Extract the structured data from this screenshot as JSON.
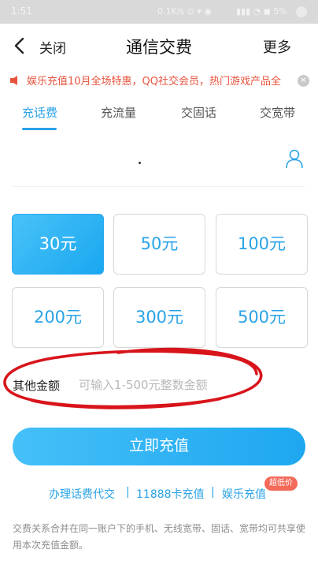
{
  "status_bar": {
    "time": "1:51",
    "center": "0.1K/s ⊙ ▾ ◉",
    "right": "▮▮▮ ◔ ◼ 5%"
  },
  "nav": {
    "back_icon": "chevron-left-icon",
    "close_label": "关闭",
    "title": "通信交费",
    "more_label": "更多"
  },
  "notice": {
    "icon": "speaker-icon",
    "text": "娱乐充值10月全场特惠，QQ社交会员，热门游戏产品全",
    "close_icon": "close-icon",
    "color": "#e8533d"
  },
  "tabs": [
    {
      "label": "充话费",
      "active": true
    },
    {
      "label": "充流量",
      "active": false
    },
    {
      "label": "交固话",
      "active": false
    },
    {
      "label": "交宽带",
      "active": false
    }
  ],
  "phone": {
    "contact_icon": "contact-icon"
  },
  "amounts": [
    {
      "label": "30元",
      "selected": true
    },
    {
      "label": "50元",
      "selected": false
    },
    {
      "label": "100元",
      "selected": false
    },
    {
      "label": "200元",
      "selected": false
    },
    {
      "label": "300元",
      "selected": false
    },
    {
      "label": "500元",
      "selected": false
    }
  ],
  "other_amount": {
    "label": "其他金额",
    "placeholder": "可输入1-500元整数金额"
  },
  "recharge_button": {
    "label": "立即充值"
  },
  "links": {
    "agent": "办理话费代交",
    "sep1": "|",
    "card": "11888卡充值",
    "sep2": "|",
    "ent": "娱乐充值",
    "badge": "超低价"
  },
  "footer_note": "交费关系合并在同一账户下的手机、无线宽带、固话、宽带均可共享使用本次充值金额。",
  "colors": {
    "accent": "#2aa3e6",
    "selected_bg": "#1aa7f0",
    "badge": "#f36a5a",
    "annotation": "#d8141b"
  }
}
